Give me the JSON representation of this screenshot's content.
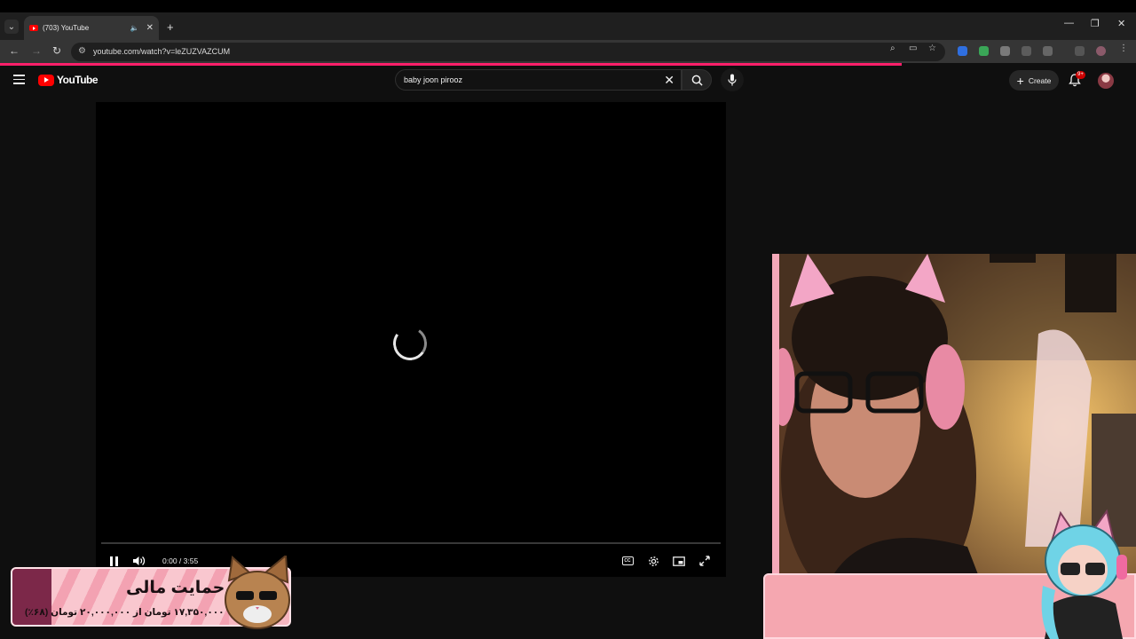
{
  "browser": {
    "tab_title": "(703) YouTube",
    "url": "youtube.com/watch?v=leZUZVAZCUM"
  },
  "youtube": {
    "logo_text": "YouTube",
    "search_query": "baby joon pirooz",
    "create_label": "Create",
    "notification_count": "9+"
  },
  "player": {
    "time_display": "0:00 / 3:55",
    "progress": 0.0,
    "state": "loading"
  },
  "overlay": {
    "support_title": "حمایت مالی",
    "support_subtitle": "۱۷,۳۵۰,۰۰۰ تومان از ۲۰,۰۰۰,۰۰۰ تومان (۶۸٪)"
  },
  "colors": {
    "accent": "#ff0000",
    "stream_pink": "#f5a7b0",
    "browser_loading_bar": "#ff1f6a"
  }
}
